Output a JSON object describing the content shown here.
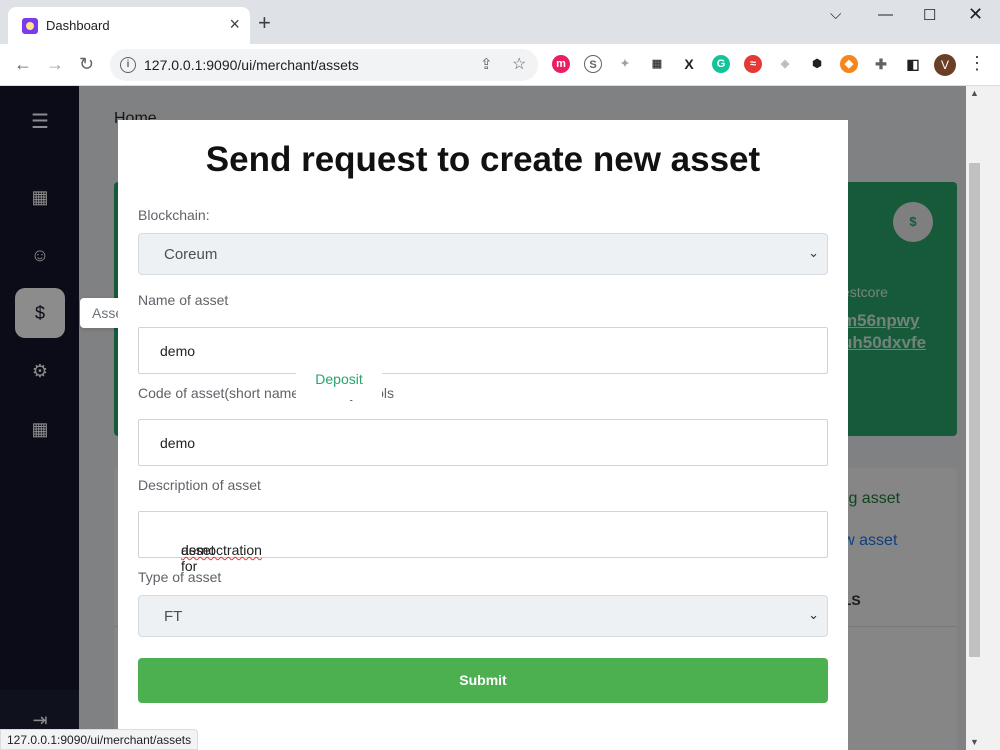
{
  "browser": {
    "tab_title": "Dashboard",
    "url": "127.0.0.1:9090/ui/merchant/assets",
    "profile_initial": "V",
    "status_url": "127.0.0.1:9090/ui/merchant/assets"
  },
  "sidebar": {
    "tooltip": "Assets",
    "items": [
      "menu-icon",
      "dashboard-icon",
      "user-icon",
      "dollar-icon",
      "gear-icon",
      "grid-icon",
      "logout-icon"
    ]
  },
  "background": {
    "breadcrumb_title": "Home",
    "card_label": "estcore",
    "card_addr_line1": "m56npwy",
    "card_addr_line2": "uh50dxvfe",
    "link_existing": "xisting asset",
    "link_new": "e new asset",
    "panel_header": "ETAILS"
  },
  "modal": {
    "title": "Send request to create new asset",
    "blockchain_label": "Blockchain:",
    "blockchain_value": "Coreum",
    "name_label": "Name of asset",
    "name_value": "demo",
    "code_label": "Code of asset(short name, three symbols",
    "code_value": "demo",
    "description_label": "Description of asset",
    "description_prefix": "asset for ",
    "description_word": "democtration",
    "type_label": "Type of asset",
    "type_value": "FT",
    "submit_label": "Submit",
    "deposit_label": "Deposit"
  },
  "colors": {
    "sidebar": "#14162b",
    "card_green": "#28a56a",
    "submit_green": "#4caf50"
  }
}
